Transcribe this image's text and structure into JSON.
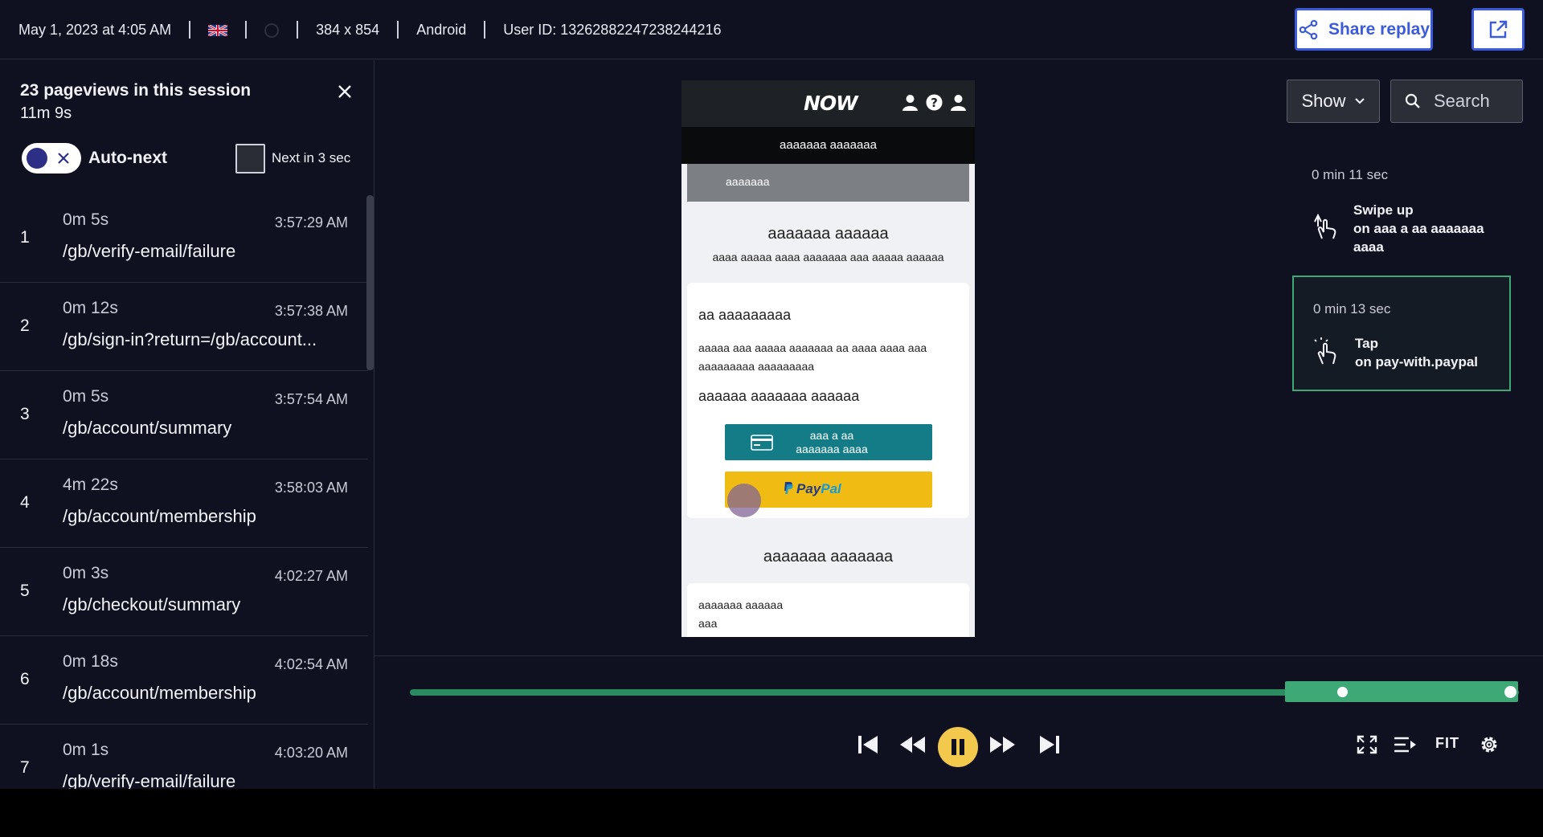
{
  "topbar": {
    "datetime": "May 1, 2023 at 4:05 AM",
    "flag_icon": "uk-flag-icon",
    "resolution": "384 x 854",
    "platform": "Android",
    "user_id": "User ID: 13262882247238244216",
    "share_label": "Share replay"
  },
  "session": {
    "title": "23 pageviews in this session",
    "duration": "11m 9s",
    "auto_next_label": "Auto-next",
    "next_label": "Next in 3 sec",
    "pageviews": [
      {
        "num": "1",
        "duration": "0m 5s",
        "time": "3:57:29 AM",
        "path": "/gb/verify-email/failure"
      },
      {
        "num": "2",
        "duration": "0m 12s",
        "time": "3:57:38 AM",
        "path": "/gb/sign-in?return=/gb/account..."
      },
      {
        "num": "3",
        "duration": "0m 5s",
        "time": "3:57:54 AM",
        "path": "/gb/account/summary"
      },
      {
        "num": "4",
        "duration": "4m 22s",
        "time": "3:58:03 AM",
        "path": "/gb/account/membership"
      },
      {
        "num": "5",
        "duration": "0m 3s",
        "time": "4:02:27 AM",
        "path": "/gb/checkout/summary"
      },
      {
        "num": "6",
        "duration": "0m 18s",
        "time": "4:02:54 AM",
        "path": "/gb/account/membership"
      },
      {
        "num": "7",
        "duration": "0m 1s",
        "time": "4:03:20 AM",
        "path": "/gb/verify-email/failure"
      }
    ]
  },
  "phone": {
    "logo": "NOW",
    "subheader": "aaaaaaa aaaaaaa",
    "banner_text": "aaaaaaa",
    "heading1": "aaaaaaa aaaaaa",
    "subtext1": "aaaa aaaaa aaaa aaaaaaa aaa aaaaa aaaaaa",
    "card_title": "aa aaaaaaaaa",
    "card_text": "aaaaa aaa aaaaa aaaaaaa aa aaaa aaaa aaa aaaaaaaaa aaaaaaaaa",
    "card_subtitle": "aaaaaa aaaaaaa aaaaaa",
    "card_button": "aaa a aa aaaaaaa aaaa",
    "paypal_pay": "Pay",
    "paypal_pal": "Pal",
    "heading2": "aaaaaaa aaaaaaa",
    "card2_line1": "aaaaaaa aaaaaa",
    "card2_line2": "aaa"
  },
  "right": {
    "show_label": "Show",
    "search_placeholder": "Search",
    "events": [
      {
        "time": "0 min 11 sec",
        "action": "Swipe up",
        "target": "on aaa a aa aaaaaaa aaaa",
        "icon": "swipe-up-icon"
      },
      {
        "time": "0 min 13 sec",
        "action": "Tap",
        "target": "on pay-with.paypal",
        "icon": "tap-icon"
      }
    ]
  },
  "player": {
    "fit_label": "FIT",
    "progress": 0.98,
    "accent": "#3ea877",
    "play_color": "#f2c94c"
  }
}
